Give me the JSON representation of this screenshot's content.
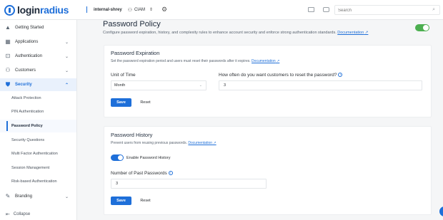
{
  "brand": {
    "name_prefix": "login",
    "name_suffix": "radius"
  },
  "topbar": {
    "app_name": "internal-shrey",
    "ciam_label": "CIAM",
    "search_placeholder": "Search"
  },
  "sidebar": {
    "items": [
      {
        "label": "Getting Started",
        "icon": "rocket-icon"
      },
      {
        "label": "Applications",
        "icon": "grid-icon"
      },
      {
        "label": "Authentication",
        "icon": "login-icon"
      },
      {
        "label": "Customers",
        "icon": "users-icon"
      },
      {
        "label": "Security",
        "icon": "shield-icon"
      },
      {
        "label": "Branding",
        "icon": "brush-icon"
      }
    ],
    "security_subitems": [
      "Attack Protection",
      "PIN Authentication",
      "Password Policy",
      "Security Questions",
      "Multi Factor Authentication",
      "Session Management",
      "Risk-based Authentication"
    ],
    "collapse_label": "Collapse"
  },
  "page": {
    "title": "Password Policy",
    "subtitle": "Configure password expiration, history, and complexity rules to enhance account security and enforce strong authentication standards.",
    "doc_link": "Documentation",
    "enabled": true
  },
  "expiration": {
    "title": "Password Expiration",
    "desc": "Set the password expiration period and users must reset their passwords after it expires.",
    "doc_link": "Documentation",
    "unit_label": "Unit of Time",
    "unit_value": "Month",
    "how_often_label": "How often do you want customers to reset the password?",
    "how_often_value": "3",
    "save_label": "Save",
    "reset_label": "Reset"
  },
  "history": {
    "title": "Password History",
    "desc": "Prevent users from reusing previous passwords.",
    "doc_link": "Documentation",
    "toggle_label": "Enable Password History",
    "toggle_on": true,
    "past_label": "Number of Past Passwords",
    "past_value": "3",
    "save_label": "Save",
    "reset_label": "Reset"
  },
  "colors": {
    "accent": "#1e6fd9",
    "toggle_green": "#4caf50"
  }
}
